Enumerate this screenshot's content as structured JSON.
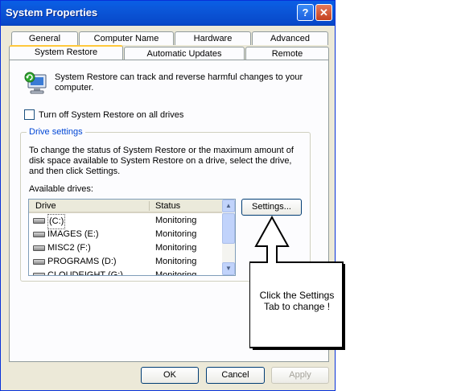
{
  "window": {
    "title": "System Properties",
    "help_glyph": "?",
    "close_glyph": "✕"
  },
  "tabs_row1": [
    "General",
    "Computer Name",
    "Hardware",
    "Advanced"
  ],
  "tabs_row2": [
    "System Restore",
    "Automatic Updates",
    "Remote"
  ],
  "active_tab": "System Restore",
  "intro": {
    "text": "System Restore can track and reverse harmful changes to your computer.",
    "icon": "system-restore-icon"
  },
  "turn_off_checkbox": {
    "label": "Turn off System Restore on all drives",
    "checked": false
  },
  "drive_settings": {
    "group_label": "Drive settings",
    "description": "To change the status of System Restore or the maximum amount of disk space available to System Restore on a drive, select the drive, and then click Settings.",
    "available_label": "Available drives:",
    "columns": [
      "Drive",
      "Status"
    ],
    "drives": [
      {
        "name": "(C:)",
        "status": "Monitoring"
      },
      {
        "name": "IMAGES (E:)",
        "status": "Monitoring"
      },
      {
        "name": "MISC2 (F:)",
        "status": "Monitoring"
      },
      {
        "name": "PROGRAMS (D:)",
        "status": "Monitoring"
      },
      {
        "name": "CLOUDEIGHT (G:)",
        "status": "Monitoring"
      }
    ],
    "settings_button": "Settings..."
  },
  "buttons": {
    "ok": "OK",
    "cancel": "Cancel",
    "apply": "Apply"
  },
  "annotation": {
    "text": "Click the Settings Tab to change !"
  },
  "colors": {
    "title_bar": "#0a5fe6",
    "dialog_bg": "#ece9d8",
    "active_tab_highlight": "#ffc83c",
    "group_label": "#0046d5"
  }
}
